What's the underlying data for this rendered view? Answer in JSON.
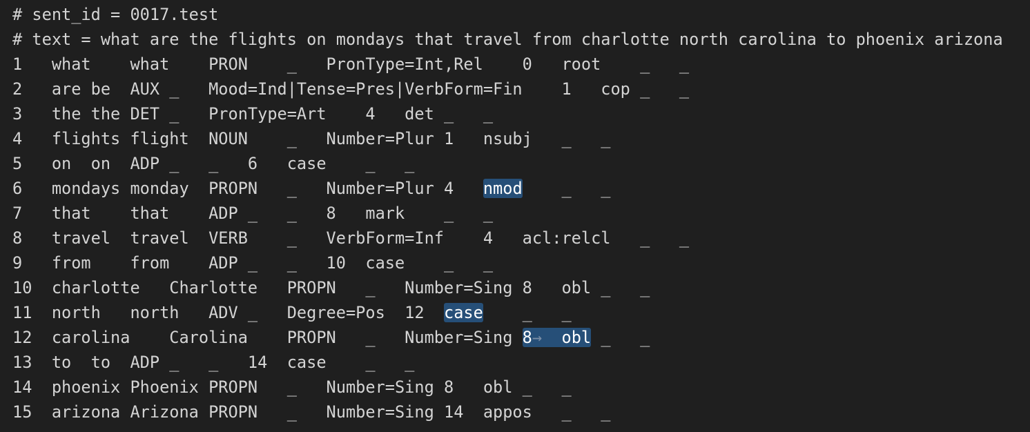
{
  "editor": {
    "lines": [
      "# sent_id = 0017.test",
      "# text = what are the flights on mondays that travel from charlotte north carolina to phoenix arizona",
      "1   what    what    PRON    _   PronType=Int,Rel    0   root    _   _",
      "2   are be  AUX _   Mood=Ind|Tense=Pres|VerbForm=Fin    1   cop _   _",
      "3   the the DET _   PronType=Art    4   det _   _",
      "4   flights flight  NOUN    _   Number=Plur 1   nsubj   _   _",
      "5   on  on  ADP _   _   6   case    _   _",
      "6   mondays monday  PROPN   _   Number=Plur 4   nmod    _   _",
      "7   that    that    ADP _   _   8   mark    _   _",
      "8   travel  travel  VERB    _   VerbForm=Inf    4   acl:relcl   _   _",
      "9   from    from    ADP _   _   10  case    _   _",
      "10  charlotte   Charlotte   PROPN   _   Number=Sing 8   obl _   _",
      "11  north   north   ADV _   Degree=Pos  12  case    _   _",
      "12  carolina    Carolina    PROPN   _   Number=Sing 8   obl _   _",
      "13  to  to  ADP _   _   14  case    _   _",
      "14  phoenix Phoenix PROPN   _   Number=Sing 8   obl _   _",
      "15  arizona Arizona PROPN   _   Number=Sing 14  appos   _   _"
    ]
  }
}
